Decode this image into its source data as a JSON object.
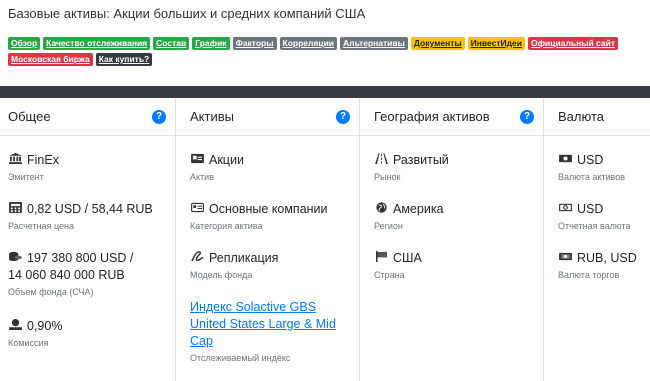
{
  "page": {
    "title": "Базовые активы: Акции больших и средних компаний США"
  },
  "tags": {
    "row1": [
      {
        "label": "Обзор",
        "color": "green"
      },
      {
        "label": "Качество отслеживания",
        "color": "green"
      },
      {
        "label": "Состав",
        "color": "green"
      },
      {
        "label": "График",
        "color": "green"
      },
      {
        "label": "Факторы",
        "color": "gray"
      },
      {
        "label": "Корреляции",
        "color": "gray"
      },
      {
        "label": "Альтернативы",
        "color": "gray"
      },
      {
        "label": "Документы",
        "color": "yellow"
      },
      {
        "label": "ИнвестИдеи",
        "color": "yellow"
      },
      {
        "label": "Официальный сайт",
        "color": "red"
      }
    ],
    "row2": [
      {
        "label": "Московская биржа",
        "color": "red"
      },
      {
        "label": "Как купить?",
        "color": "dark"
      }
    ]
  },
  "colors": {
    "green": "#28a745",
    "gray": "#6c757d",
    "yellow": "#ffc107",
    "red": "#dc3545",
    "dark": "#343a40",
    "link": "#007bff"
  },
  "columns": {
    "general": {
      "header": "Общее",
      "issuer": {
        "icon": "bank-icon",
        "value": "FinEx",
        "label": "Эмитент"
      },
      "price": {
        "icon": "calculator-icon",
        "value": "0,82 USD / 58,44 RUB",
        "label": "Расчетная цена"
      },
      "fund_size": {
        "icon": "coins-icon",
        "value_line1": "197 380 800 USD /",
        "value_line2": "14 060 840 000 RUB",
        "label": "Объем фонда (СЧА)"
      },
      "fee": {
        "icon": "commission-icon",
        "value": "0,90%",
        "label": "Комиссия"
      }
    },
    "assets": {
      "header": "Активы",
      "asset": {
        "icon": "id-card-icon",
        "value": "Акции",
        "label": "Актив"
      },
      "category": {
        "icon": "id-card-outline-icon",
        "value": "Основные компании",
        "label": "Категория актива"
      },
      "model": {
        "icon": "signature-icon",
        "value": "Репликация",
        "label": "Модель фонда"
      },
      "index": {
        "value": "Индекс Solactive GBS United States Large & Mid Cap",
        "label": "Отслеживаемый индекс"
      }
    },
    "geo": {
      "header": "География активов",
      "market": {
        "icon": "road-icon",
        "value": "Развитый",
        "label": "Рынок"
      },
      "region": {
        "icon": "globe-icon",
        "value": "Америка",
        "label": "Регион"
      },
      "country": {
        "icon": "flag-icon",
        "value": "США",
        "label": "Страна"
      }
    },
    "currency": {
      "header": "Валюта",
      "asset_currency": {
        "icon": "money-bill-icon",
        "value": "USD",
        "label": "Валюта активов"
      },
      "report_currency": {
        "icon": "money-bill-outline-icon",
        "value": "USD",
        "label": "Отчетная валюта"
      },
      "trade_currency": {
        "icon": "money-bill-wave-icon",
        "value": "RUB, USD",
        "label": "Валюта торгов"
      }
    }
  },
  "help_glyph": "?"
}
